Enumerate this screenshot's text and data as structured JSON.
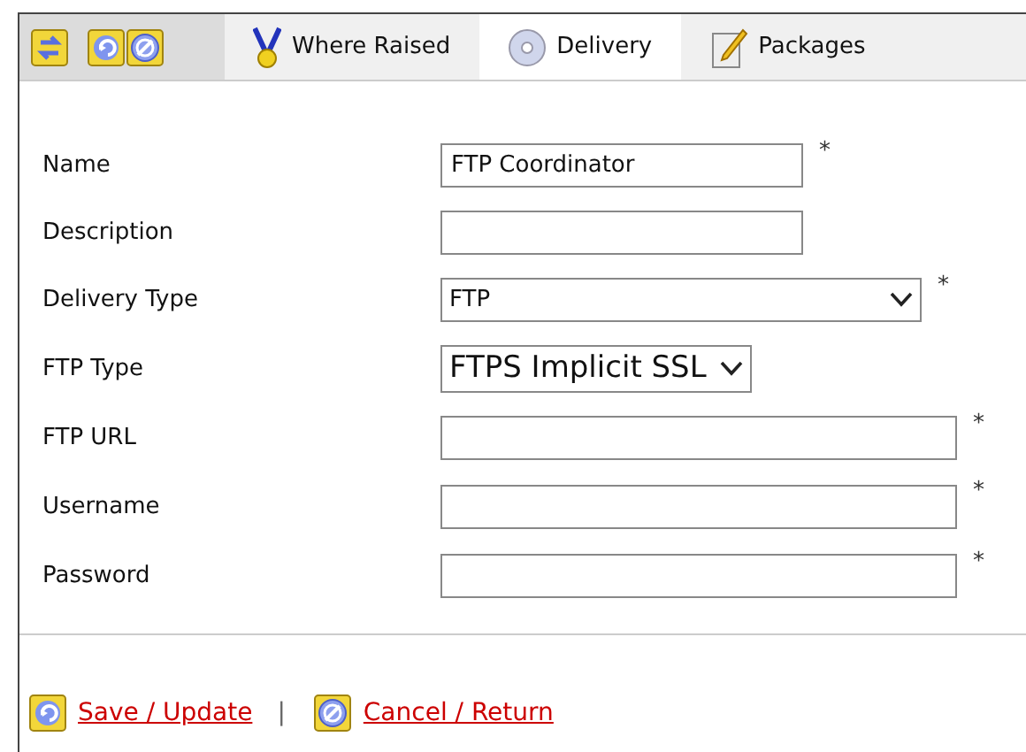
{
  "tabs": [
    {
      "label": "Where Raised",
      "kind": "medal",
      "selected": false
    },
    {
      "label": "Delivery",
      "kind": "disc",
      "selected": true
    },
    {
      "label": "Packages",
      "kind": "note",
      "selected": false
    }
  ],
  "fields": [
    {
      "label": "Name",
      "kind": "text",
      "value": "FTP Coordinator",
      "required": true
    },
    {
      "label": "Description",
      "kind": "text",
      "required": false
    },
    {
      "label": "Delivery Type",
      "kind": "select",
      "value": "FTP",
      "required": true
    },
    {
      "label": "FTP Type",
      "kind": "select",
      "value": "FTPS Implicit SSL",
      "required": false
    },
    {
      "label": "FTP URL",
      "kind": "text",
      "required": true
    },
    {
      "label": "Username",
      "kind": "text",
      "required": true
    },
    {
      "label": "Password",
      "kind": "text",
      "required": true
    }
  ],
  "required_mark": "*",
  "actions": [
    {
      "label": "Save / Update",
      "kind": "save"
    },
    {
      "label": "Cancel / Return",
      "kind": "cancel"
    }
  ],
  "separator": "|"
}
